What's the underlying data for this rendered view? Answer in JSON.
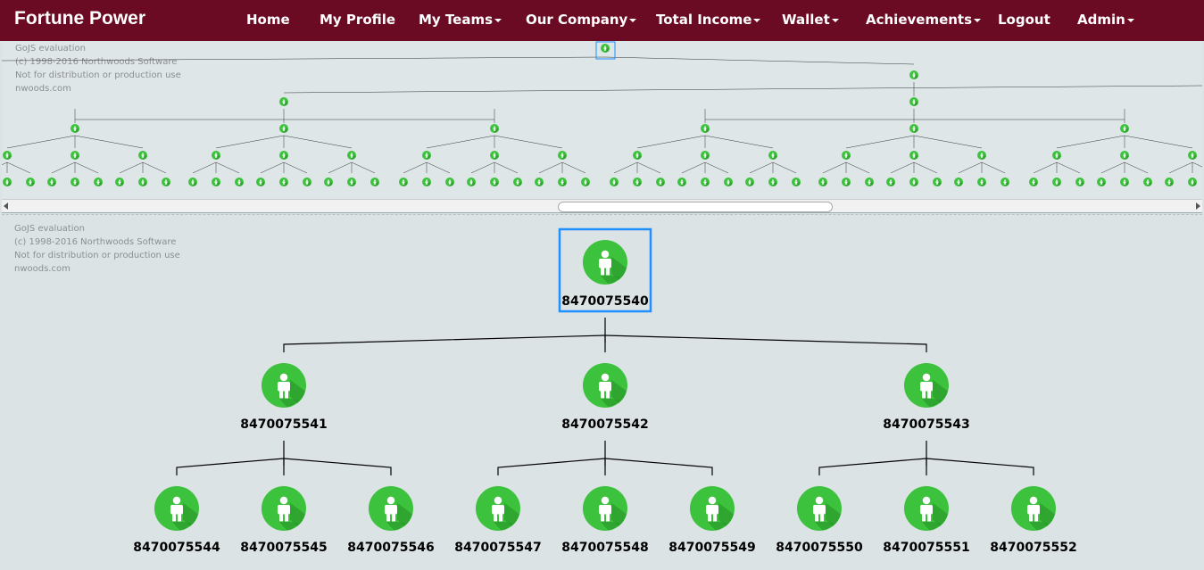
{
  "navbar": {
    "brand": "Fortune Power",
    "items": [
      {
        "label": "Home"
      },
      {
        "label": "My Profile"
      },
      {
        "label": "My Teams"
      },
      {
        "label": "Our Company"
      },
      {
        "label": "Total Income"
      },
      {
        "label": "Wallet"
      },
      {
        "label": "Achievements"
      },
      {
        "label": "Logout"
      },
      {
        "label": "Admin"
      }
    ]
  },
  "watermark": {
    "line1": "GoJS evaluation",
    "line2": "(c) 1998-2016 Northwoods Software",
    "line3": "Not for distribution or production use",
    "line4": "nwoods.com"
  },
  "tree": {
    "root": "8470075540",
    "level1": [
      "8470075541",
      "8470075542",
      "8470075543"
    ],
    "level2": [
      "8470075544",
      "8470075545",
      "8470075546",
      "8470075547",
      "8470075548",
      "8470075549",
      "8470075550",
      "8470075551",
      "8470075552"
    ]
  },
  "colors": {
    "navbar": "#6b0a23",
    "node": "#3cc23c",
    "node_shadow": "#2a9a2a",
    "selection": "#1e90ff"
  },
  "icons": {
    "node": "person-icon"
  }
}
